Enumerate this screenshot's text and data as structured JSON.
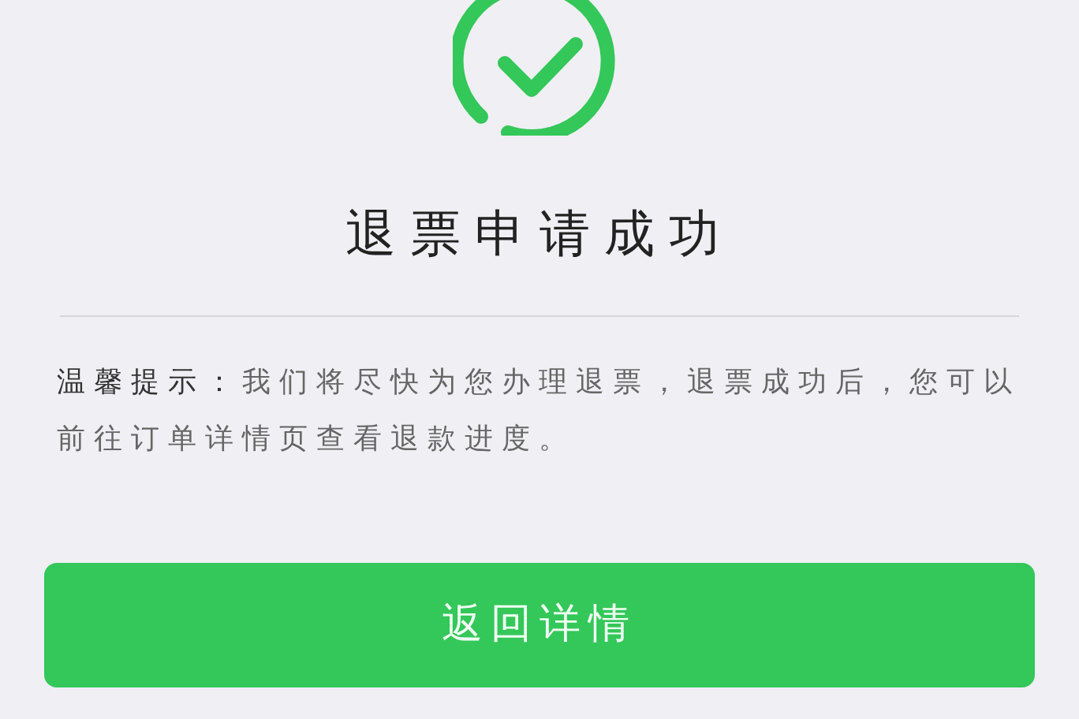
{
  "status": {
    "title": "退票申请成功"
  },
  "tip": {
    "label": "温馨提示：",
    "text": "我们将尽快为您办理退票，退票成功后，您可以前往订单详情页查看退款进度。"
  },
  "buttons": [
    {
      "label": "返回详情"
    }
  ]
}
